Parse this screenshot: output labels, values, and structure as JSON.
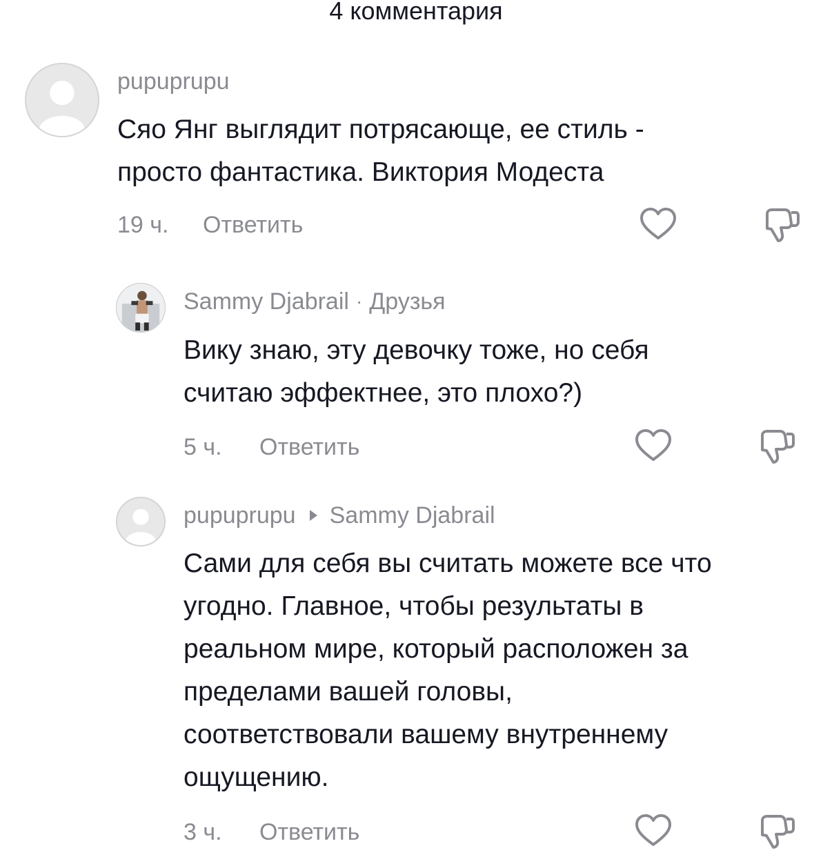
{
  "header": {
    "title": "4 комментария"
  },
  "comments": [
    {
      "username": "pupuprupu",
      "text": "Сяо Янг выглядит потрясающе, ее стиль -\nпросто фантастика. Виктория Модеста",
      "time": "19 ч.",
      "reply_label": "Ответить",
      "like_icon": "heart-icon",
      "dislike_icon": "thumbs-down-icon"
    },
    {
      "username": "Sammy Djabrail",
      "separator": "·",
      "badge": "Друзья",
      "text": "Вику знаю, эту девочку тоже, но себя\nсчитаю эффектнее, это плохо?)",
      "time": "5 ч.",
      "reply_label": "Ответить",
      "like_icon": "heart-icon",
      "dislike_icon": "thumbs-down-icon"
    },
    {
      "username": "pupuprupu",
      "reply_to": "Sammy Djabrail",
      "text": "Сами для себя вы считать можете все что\nугодно. Главное, чтобы результаты в\nреальном мире, который расположен за\nпределами вашей головы,\nсоответствовали вашему внутреннему\nощущению.",
      "time": "3 ч.",
      "reply_label": "Ответить",
      "like_icon": "heart-icon",
      "dislike_icon": "thumbs-down-icon"
    }
  ],
  "colors": {
    "text_primary": "#161823",
    "text_secondary": "#8a8b91",
    "background": "#ffffff",
    "avatar_placeholder": "#e6e6e6"
  }
}
